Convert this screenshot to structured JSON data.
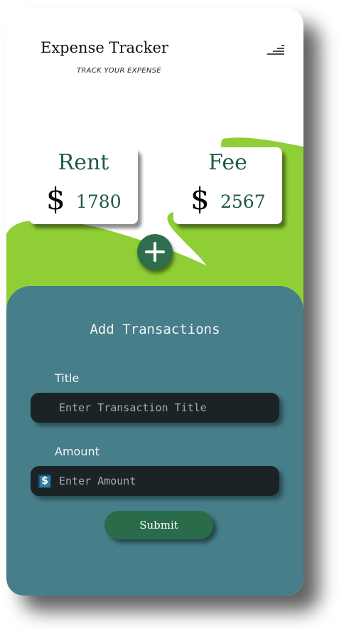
{
  "header": {
    "title": "Expense Tracker",
    "subtitle": "TRACK YOUR EXPENSE",
    "menu_icon": "hamburger-menu-icon"
  },
  "summary_cards": [
    {
      "label": "Rent",
      "currency": "$",
      "amount": "1780"
    },
    {
      "label": "Fee",
      "currency": "$",
      "amount": "2567"
    }
  ],
  "add_button": {
    "icon": "plus-icon"
  },
  "form": {
    "heading": "Add Transactions",
    "title_label": "Title",
    "title_placeholder": "Enter Transaction Title",
    "title_value": "",
    "amount_label": "Amount",
    "amount_placeholder": "Enter Amount",
    "amount_value": "",
    "amount_icon": "$",
    "submit_label": "Submit"
  },
  "colors": {
    "accent_green": "#8fcf35",
    "panel_teal": "#467e89",
    "dark_green": "#2f6e4d",
    "card_text": "#1e5a48",
    "field_background": "#1b2326"
  }
}
